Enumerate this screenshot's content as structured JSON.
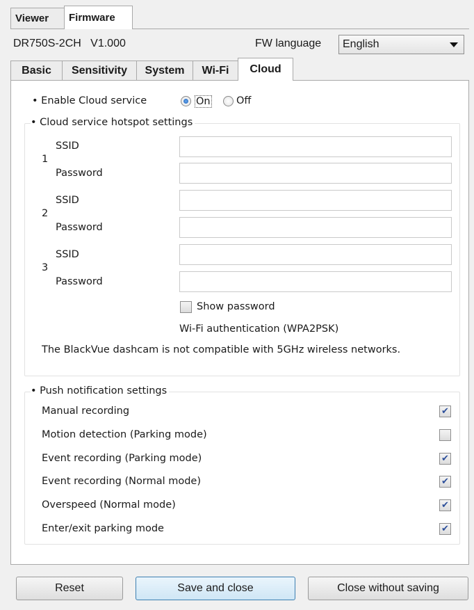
{
  "top_tabs": [
    {
      "label": "Viewer",
      "active": false
    },
    {
      "label": "Firmware",
      "active": true
    }
  ],
  "device": {
    "model": "DR750S-2CH",
    "version": "V1.000",
    "fw_language_label": "FW language",
    "fw_language_value": "English"
  },
  "sub_tabs": [
    {
      "label": "Basic",
      "active": false
    },
    {
      "label": "Sensitivity",
      "active": false
    },
    {
      "label": "System",
      "active": false
    },
    {
      "label": "Wi-Fi",
      "active": false
    },
    {
      "label": "Cloud",
      "active": true
    }
  ],
  "cloud": {
    "enable_label": "Enable Cloud service",
    "on_label": "On",
    "off_label": "Off",
    "enabled": true,
    "hotspot_title": "Cloud service hotspot settings",
    "hotspots": [
      {
        "number": "1",
        "ssid_label": "SSID",
        "password_label": "Password",
        "ssid_value": "",
        "password_value": ""
      },
      {
        "number": "2",
        "ssid_label": "SSID",
        "password_label": "Password",
        "ssid_value": "",
        "password_value": ""
      },
      {
        "number": "3",
        "ssid_label": "SSID",
        "password_label": "Password",
        "ssid_value": "",
        "password_value": ""
      }
    ],
    "show_password_label": "Show password",
    "show_password_checked": false,
    "auth_note": "Wi-Fi authentication (WPA2PSK)",
    "compat_note": "The BlackVue dashcam is not compatible with 5GHz wireless networks."
  },
  "push": {
    "title": "Push notification settings",
    "items": [
      {
        "label": "Manual recording",
        "checked": true
      },
      {
        "label": "Motion detection (Parking mode)",
        "checked": false
      },
      {
        "label": "Event recording (Parking mode)",
        "checked": true
      },
      {
        "label": "Event recording (Normal mode)",
        "checked": true
      },
      {
        "label": "Overspeed (Normal mode)",
        "checked": true
      },
      {
        "label": "Enter/exit parking mode",
        "checked": true
      }
    ]
  },
  "buttons": {
    "reset": "Reset",
    "save_close": "Save and close",
    "close_no_save": "Close without saving"
  },
  "icons": {
    "dropdown": "chevron-down-icon",
    "checkmark": "checkmark-icon"
  },
  "colors": {
    "accent": "#3c7fb1",
    "checkmark": "#2c4f9a"
  }
}
